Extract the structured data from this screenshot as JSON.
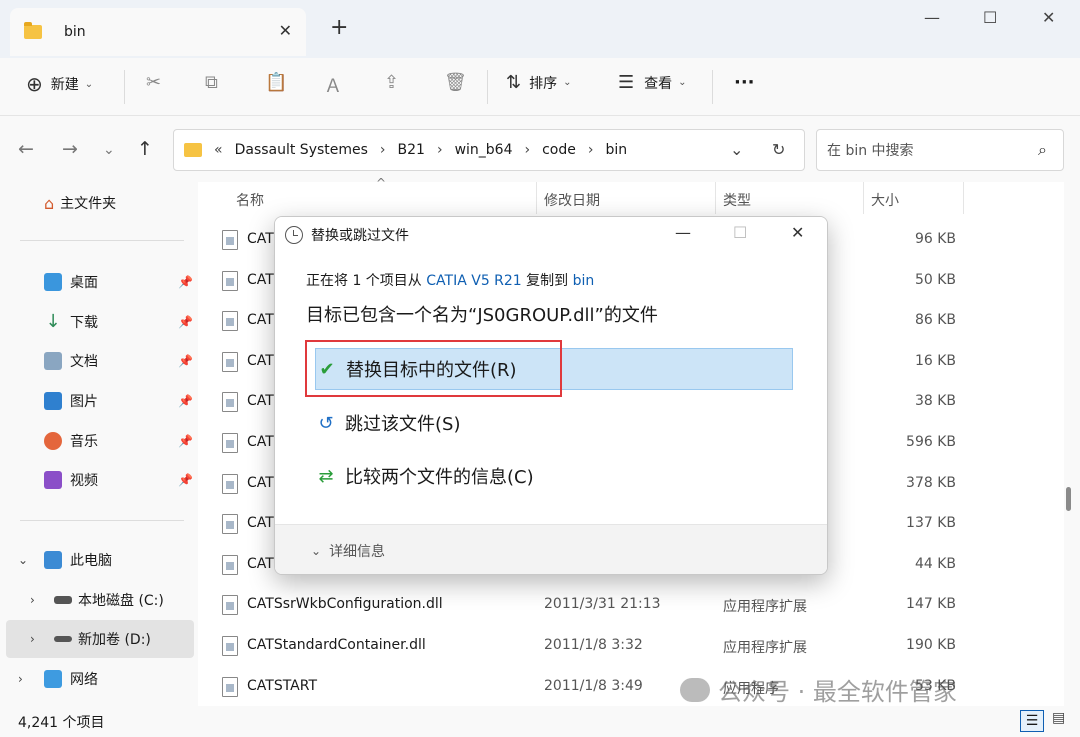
{
  "tab": {
    "title": "bin",
    "close": "✕",
    "new": "+"
  },
  "window": {
    "minimize": "—",
    "maximize": "☐",
    "close": "✕"
  },
  "toolbar": {
    "new_label": "新建",
    "sort_label": "排序",
    "view_label": "查看",
    "more_label": "···"
  },
  "breadcrumb": {
    "prefix": "«",
    "items": [
      "Dassault Systemes",
      "B21",
      "win_b64",
      "code",
      "bin"
    ]
  },
  "search": {
    "placeholder": "在 bin 中搜索"
  },
  "sidebar": {
    "home": "主文件夹",
    "quick": [
      "桌面",
      "下载",
      "文档",
      "图片",
      "音乐",
      "视频"
    ],
    "this_pc": "此电脑",
    "drives": [
      "本地磁盘 (C:)",
      "新加卷 (D:)"
    ],
    "network": "网络"
  },
  "columns": {
    "name": "名称",
    "date": "修改日期",
    "type": "类型",
    "size": "大小"
  },
  "files": [
    {
      "name": "CAT",
      "date": "",
      "type": "",
      "size": "96 KB"
    },
    {
      "name": "CAT",
      "date": "",
      "type": "",
      "size": "50 KB"
    },
    {
      "name": "CAT",
      "date": "",
      "type": "",
      "size": "86 KB"
    },
    {
      "name": "CAT",
      "date": "",
      "type": "",
      "size": "16 KB"
    },
    {
      "name": "CAT",
      "date": "",
      "type": "",
      "size": "38 KB"
    },
    {
      "name": "CAT",
      "date": "",
      "type": "",
      "size": "596 KB"
    },
    {
      "name": "CAT",
      "date": "",
      "type": "",
      "size": "378 KB"
    },
    {
      "name": "CAT",
      "date": "",
      "type": "",
      "size": "137 KB"
    },
    {
      "name": "CAT",
      "date": "",
      "type": "",
      "size": "44 KB"
    },
    {
      "name": "CATSsrWkbConfiguration.dll",
      "date": "2011/3/31 21:13",
      "type": "应用程序扩展",
      "size": "147 KB"
    },
    {
      "name": "CATStandardContainer.dll",
      "date": "2011/1/8 3:32",
      "type": "应用程序扩展",
      "size": "190 KB"
    },
    {
      "name": "CATSTART",
      "date": "2011/1/8 3:49",
      "type": "应用程序",
      "size": "53 KB"
    }
  ],
  "status": {
    "count": "4,241 个项目"
  },
  "dialog": {
    "title": "替换或跳过文件",
    "line1_pre": "正在将 1 个项目从 ",
    "line1_src": "CATIA V5 R21",
    "line1_mid": " 复制到 ",
    "line1_dst": "bin",
    "line2": "目标已包含一个名为“JS0GROUP.dll”的文件",
    "replace": "替换目标中的文件(R)",
    "skip": "跳过该文件(S)",
    "compare": "比较两个文件的信息(C)",
    "details": "详细信息"
  },
  "watermark": "公众号 · 最全软件管家",
  "colors": {
    "accent": "#0f5fb2",
    "selection": "#cce4f7",
    "highlight": "#e0393c"
  }
}
